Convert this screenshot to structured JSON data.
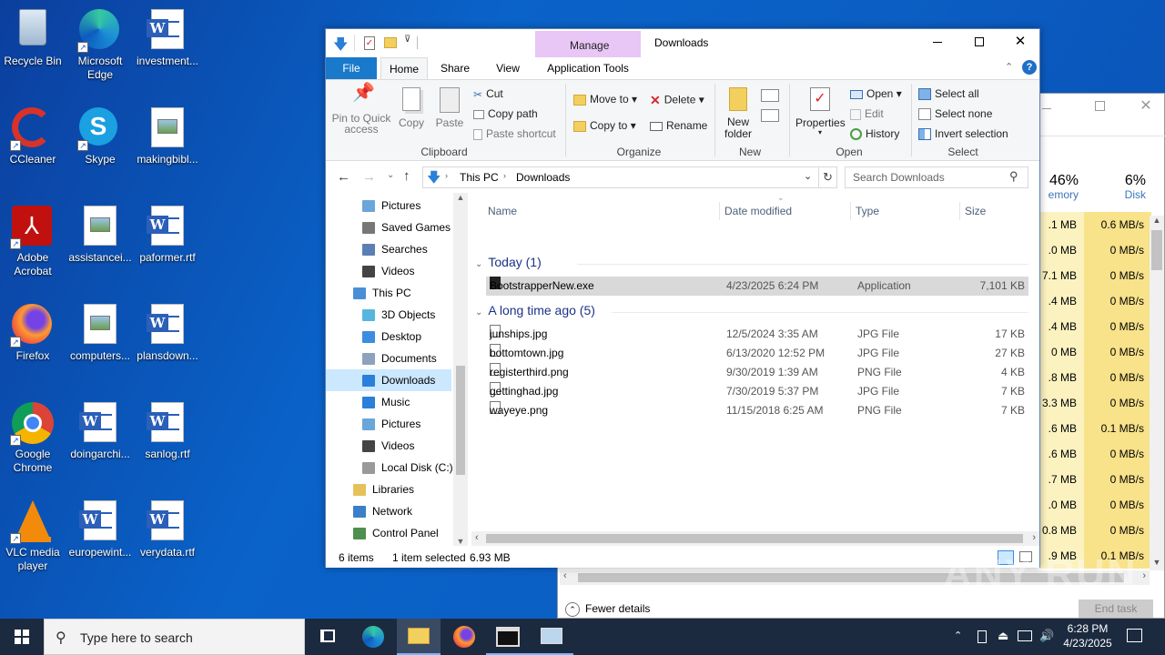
{
  "desktop": {
    "icons": [
      {
        "label": "Recycle Bin",
        "type": "recycle"
      },
      {
        "label": "Microsoft Edge",
        "type": "edge"
      },
      {
        "label": "investment...",
        "type": "word"
      },
      {
        "label": "CCleaner",
        "type": "ccleaner"
      },
      {
        "label": "Skype",
        "type": "skype"
      },
      {
        "label": "makingbibl...",
        "type": "picture"
      },
      {
        "label": "Adobe Acrobat",
        "type": "acrobat"
      },
      {
        "label": "assistancei...",
        "type": "picture"
      },
      {
        "label": "paformer.rtf",
        "type": "word"
      },
      {
        "label": "Firefox",
        "type": "firefox"
      },
      {
        "label": "computers...",
        "type": "picture"
      },
      {
        "label": "plansdown...",
        "type": "word"
      },
      {
        "label": "Google Chrome",
        "type": "chrome"
      },
      {
        "label": "doingarchi...",
        "type": "word"
      },
      {
        "label": "sanlog.rtf",
        "type": "word"
      },
      {
        "label": "VLC media player",
        "type": "vlc"
      },
      {
        "label": "europewint...",
        "type": "word"
      },
      {
        "label": "verydata.rtf",
        "type": "word"
      }
    ]
  },
  "taskmanager": {
    "memory_pct": "46%",
    "memory_label": "emory",
    "disk_pct": "6%",
    "disk_label": "Disk",
    "rows": [
      {
        "mem": ".1 MB",
        "disk": "0.6 MB/s"
      },
      {
        "mem": ".0 MB",
        "disk": "0 MB/s"
      },
      {
        "mem": "7.1 MB",
        "disk": "0 MB/s"
      },
      {
        "mem": ".4 MB",
        "disk": "0 MB/s"
      },
      {
        "mem": ".4 MB",
        "disk": "0 MB/s"
      },
      {
        "mem": "0 MB",
        "disk": "0 MB/s"
      },
      {
        "mem": ".8 MB",
        "disk": "0 MB/s"
      },
      {
        "mem": "3.3 MB",
        "disk": "0 MB/s"
      },
      {
        "mem": ".6 MB",
        "disk": "0.1 MB/s"
      },
      {
        "mem": ".6 MB",
        "disk": "0 MB/s"
      },
      {
        "mem": ".7 MB",
        "disk": "0 MB/s"
      },
      {
        "mem": ".0 MB",
        "disk": "0 MB/s"
      },
      {
        "mem": "0.8 MB",
        "disk": "0 MB/s"
      },
      {
        "mem": ".9 MB",
        "disk": "0.1 MB/s"
      }
    ],
    "fewer_details": "Fewer details",
    "end_task": "End task"
  },
  "explorer": {
    "title": "Downloads",
    "manage_tab": "Manage",
    "tabs": {
      "file": "File",
      "home": "Home",
      "share": "Share",
      "view": "View",
      "app_tools": "Application Tools"
    },
    "clipboard": {
      "pin": "Pin to Quick access",
      "copy": "Copy",
      "paste": "Paste",
      "cut": "Cut",
      "copy_path": "Copy path",
      "paste_shortcut": "Paste shortcut",
      "label": "Clipboard"
    },
    "organize": {
      "move_to": "Move to",
      "copy_to": "Copy to",
      "delete": "Delete",
      "rename": "Rename",
      "label": "Organize"
    },
    "new": {
      "new_folder": "New folder",
      "label": "New"
    },
    "open": {
      "properties": "Properties",
      "open": "Open",
      "edit": "Edit",
      "history": "History",
      "label": "Open"
    },
    "select": {
      "select_all": "Select all",
      "select_none": "Select none",
      "invert": "Invert selection",
      "label": "Select"
    },
    "address": {
      "crumb1": "This PC",
      "crumb2": "Downloads",
      "search_placeholder": "Search Downloads"
    },
    "nav": [
      {
        "label": "Pictures",
        "indent": 2,
        "color": "#6aa6d8"
      },
      {
        "label": "Saved Games",
        "indent": 2,
        "color": "#777777"
      },
      {
        "label": "Searches",
        "indent": 2,
        "color": "#5b7fb3"
      },
      {
        "label": "Videos",
        "indent": 2,
        "color": "#444444"
      },
      {
        "label": "This PC",
        "indent": 1,
        "color": "#4a8fd6"
      },
      {
        "label": "3D Objects",
        "indent": 2,
        "color": "#58b5e0"
      },
      {
        "label": "Desktop",
        "indent": 2,
        "color": "#3b8de0"
      },
      {
        "label": "Documents",
        "indent": 2,
        "color": "#8da2bd"
      },
      {
        "label": "Downloads",
        "indent": 2,
        "color": "#2b7fd8"
      },
      {
        "label": "Music",
        "indent": 2,
        "color": "#2b7fd8"
      },
      {
        "label": "Pictures",
        "indent": 2,
        "color": "#6aa6d8"
      },
      {
        "label": "Videos",
        "indent": 2,
        "color": "#444444"
      },
      {
        "label": "Local Disk (C:)",
        "indent": 2,
        "color": "#999999"
      },
      {
        "label": "Libraries",
        "indent": 1,
        "color": "#e6c15a"
      },
      {
        "label": "Network",
        "indent": 1,
        "color": "#3b7fc9"
      },
      {
        "label": "Control Panel",
        "indent": 1,
        "color": "#4f8f4f"
      }
    ],
    "columns": {
      "name": "Name",
      "date": "Date modified",
      "type": "Type",
      "size": "Size"
    },
    "group_today": "Today (1)",
    "group_old": "A long time ago (5)",
    "today_files": [
      {
        "name": "BootstrapperNew.exe",
        "date": "4/23/2025 6:24 PM",
        "type": "Application",
        "size": "7,101 KB"
      }
    ],
    "old_files": [
      {
        "name": "junships.jpg",
        "date": "12/5/2024 3:35 AM",
        "type": "JPG File",
        "size": "17 KB"
      },
      {
        "name": "bottomtown.jpg",
        "date": "6/13/2020 12:52 PM",
        "type": "JPG File",
        "size": "27 KB"
      },
      {
        "name": "registerthird.png",
        "date": "9/30/2019 1:39 AM",
        "type": "PNG File",
        "size": "4 KB"
      },
      {
        "name": "gettinghad.jpg",
        "date": "7/30/2019 5:37 PM",
        "type": "JPG File",
        "size": "7 KB"
      },
      {
        "name": "wayeye.png",
        "date": "11/15/2018 6:25 AM",
        "type": "PNG File",
        "size": "7 KB"
      }
    ],
    "status": {
      "items": "6 items",
      "selected": "1 item selected",
      "size": "6.93 MB"
    }
  },
  "taskbar": {
    "search_placeholder": "Type here to search",
    "time": "6:28 PM",
    "date": "4/23/2025"
  },
  "watermark": "ANY RUN"
}
